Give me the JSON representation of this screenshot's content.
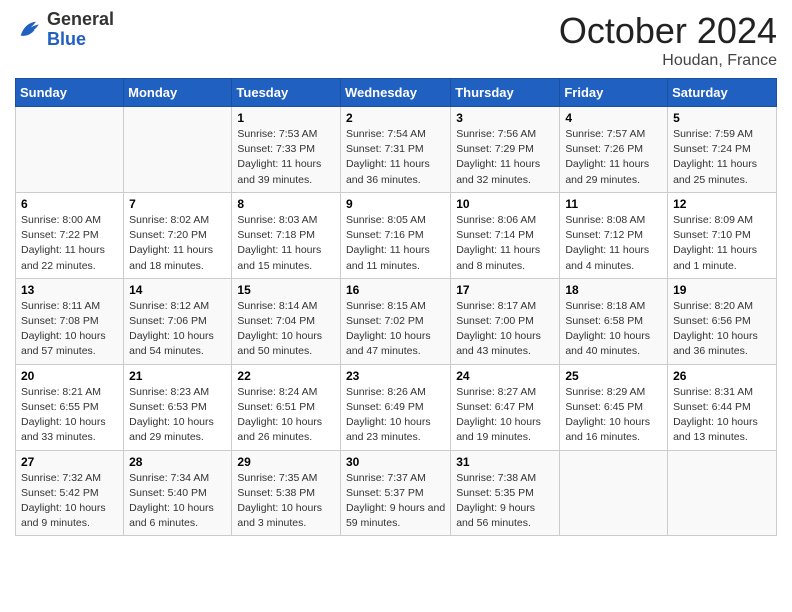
{
  "logo": {
    "general": "General",
    "blue": "Blue"
  },
  "header": {
    "month": "October 2024",
    "location": "Houdan, France"
  },
  "weekdays": [
    "Sunday",
    "Monday",
    "Tuesday",
    "Wednesday",
    "Thursday",
    "Friday",
    "Saturday"
  ],
  "weeks": [
    [
      {
        "day": "",
        "sunrise": "",
        "sunset": "",
        "daylight": ""
      },
      {
        "day": "",
        "sunrise": "",
        "sunset": "",
        "daylight": ""
      },
      {
        "day": "1",
        "sunrise": "Sunrise: 7:53 AM",
        "sunset": "Sunset: 7:33 PM",
        "daylight": "Daylight: 11 hours and 39 minutes."
      },
      {
        "day": "2",
        "sunrise": "Sunrise: 7:54 AM",
        "sunset": "Sunset: 7:31 PM",
        "daylight": "Daylight: 11 hours and 36 minutes."
      },
      {
        "day": "3",
        "sunrise": "Sunrise: 7:56 AM",
        "sunset": "Sunset: 7:29 PM",
        "daylight": "Daylight: 11 hours and 32 minutes."
      },
      {
        "day": "4",
        "sunrise": "Sunrise: 7:57 AM",
        "sunset": "Sunset: 7:26 PM",
        "daylight": "Daylight: 11 hours and 29 minutes."
      },
      {
        "day": "5",
        "sunrise": "Sunrise: 7:59 AM",
        "sunset": "Sunset: 7:24 PM",
        "daylight": "Daylight: 11 hours and 25 minutes."
      }
    ],
    [
      {
        "day": "6",
        "sunrise": "Sunrise: 8:00 AM",
        "sunset": "Sunset: 7:22 PM",
        "daylight": "Daylight: 11 hours and 22 minutes."
      },
      {
        "day": "7",
        "sunrise": "Sunrise: 8:02 AM",
        "sunset": "Sunset: 7:20 PM",
        "daylight": "Daylight: 11 hours and 18 minutes."
      },
      {
        "day": "8",
        "sunrise": "Sunrise: 8:03 AM",
        "sunset": "Sunset: 7:18 PM",
        "daylight": "Daylight: 11 hours and 15 minutes."
      },
      {
        "day": "9",
        "sunrise": "Sunrise: 8:05 AM",
        "sunset": "Sunset: 7:16 PM",
        "daylight": "Daylight: 11 hours and 11 minutes."
      },
      {
        "day": "10",
        "sunrise": "Sunrise: 8:06 AM",
        "sunset": "Sunset: 7:14 PM",
        "daylight": "Daylight: 11 hours and 8 minutes."
      },
      {
        "day": "11",
        "sunrise": "Sunrise: 8:08 AM",
        "sunset": "Sunset: 7:12 PM",
        "daylight": "Daylight: 11 hours and 4 minutes."
      },
      {
        "day": "12",
        "sunrise": "Sunrise: 8:09 AM",
        "sunset": "Sunset: 7:10 PM",
        "daylight": "Daylight: 11 hours and 1 minute."
      }
    ],
    [
      {
        "day": "13",
        "sunrise": "Sunrise: 8:11 AM",
        "sunset": "Sunset: 7:08 PM",
        "daylight": "Daylight: 10 hours and 57 minutes."
      },
      {
        "day": "14",
        "sunrise": "Sunrise: 8:12 AM",
        "sunset": "Sunset: 7:06 PM",
        "daylight": "Daylight: 10 hours and 54 minutes."
      },
      {
        "day": "15",
        "sunrise": "Sunrise: 8:14 AM",
        "sunset": "Sunset: 7:04 PM",
        "daylight": "Daylight: 10 hours and 50 minutes."
      },
      {
        "day": "16",
        "sunrise": "Sunrise: 8:15 AM",
        "sunset": "Sunset: 7:02 PM",
        "daylight": "Daylight: 10 hours and 47 minutes."
      },
      {
        "day": "17",
        "sunrise": "Sunrise: 8:17 AM",
        "sunset": "Sunset: 7:00 PM",
        "daylight": "Daylight: 10 hours and 43 minutes."
      },
      {
        "day": "18",
        "sunrise": "Sunrise: 8:18 AM",
        "sunset": "Sunset: 6:58 PM",
        "daylight": "Daylight: 10 hours and 40 minutes."
      },
      {
        "day": "19",
        "sunrise": "Sunrise: 8:20 AM",
        "sunset": "Sunset: 6:56 PM",
        "daylight": "Daylight: 10 hours and 36 minutes."
      }
    ],
    [
      {
        "day": "20",
        "sunrise": "Sunrise: 8:21 AM",
        "sunset": "Sunset: 6:55 PM",
        "daylight": "Daylight: 10 hours and 33 minutes."
      },
      {
        "day": "21",
        "sunrise": "Sunrise: 8:23 AM",
        "sunset": "Sunset: 6:53 PM",
        "daylight": "Daylight: 10 hours and 29 minutes."
      },
      {
        "day": "22",
        "sunrise": "Sunrise: 8:24 AM",
        "sunset": "Sunset: 6:51 PM",
        "daylight": "Daylight: 10 hours and 26 minutes."
      },
      {
        "day": "23",
        "sunrise": "Sunrise: 8:26 AM",
        "sunset": "Sunset: 6:49 PM",
        "daylight": "Daylight: 10 hours and 23 minutes."
      },
      {
        "day": "24",
        "sunrise": "Sunrise: 8:27 AM",
        "sunset": "Sunset: 6:47 PM",
        "daylight": "Daylight: 10 hours and 19 minutes."
      },
      {
        "day": "25",
        "sunrise": "Sunrise: 8:29 AM",
        "sunset": "Sunset: 6:45 PM",
        "daylight": "Daylight: 10 hours and 16 minutes."
      },
      {
        "day": "26",
        "sunrise": "Sunrise: 8:31 AM",
        "sunset": "Sunset: 6:44 PM",
        "daylight": "Daylight: 10 hours and 13 minutes."
      }
    ],
    [
      {
        "day": "27",
        "sunrise": "Sunrise: 7:32 AM",
        "sunset": "Sunset: 5:42 PM",
        "daylight": "Daylight: 10 hours and 9 minutes."
      },
      {
        "day": "28",
        "sunrise": "Sunrise: 7:34 AM",
        "sunset": "Sunset: 5:40 PM",
        "daylight": "Daylight: 10 hours and 6 minutes."
      },
      {
        "day": "29",
        "sunrise": "Sunrise: 7:35 AM",
        "sunset": "Sunset: 5:38 PM",
        "daylight": "Daylight: 10 hours and 3 minutes."
      },
      {
        "day": "30",
        "sunrise": "Sunrise: 7:37 AM",
        "sunset": "Sunset: 5:37 PM",
        "daylight": "Daylight: 9 hours and 59 minutes."
      },
      {
        "day": "31",
        "sunrise": "Sunrise: 7:38 AM",
        "sunset": "Sunset: 5:35 PM",
        "daylight": "Daylight: 9 hours and 56 minutes."
      },
      {
        "day": "",
        "sunrise": "",
        "sunset": "",
        "daylight": ""
      },
      {
        "day": "",
        "sunrise": "",
        "sunset": "",
        "daylight": ""
      }
    ]
  ]
}
